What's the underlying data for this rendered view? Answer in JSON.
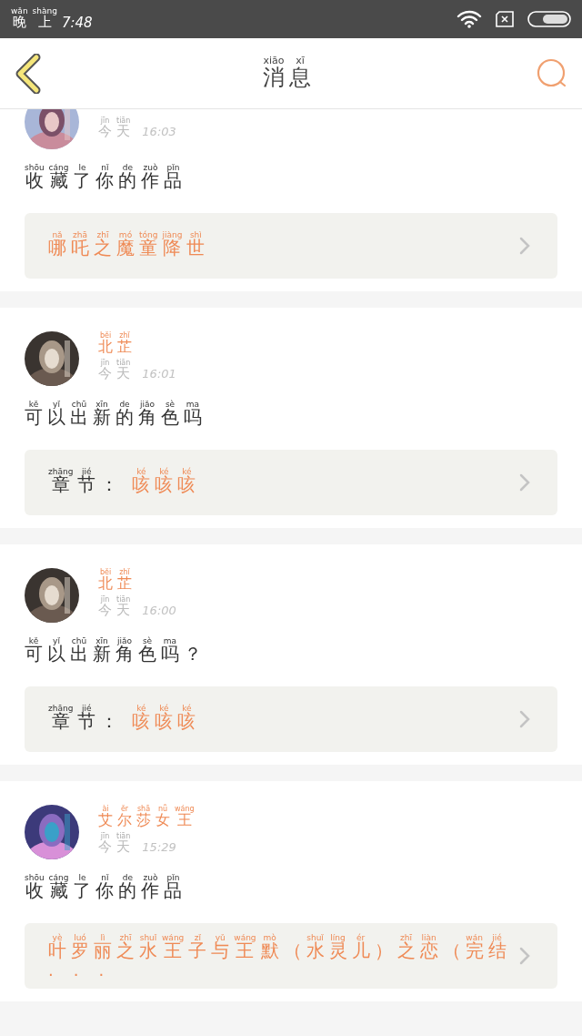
{
  "status_bar": {
    "period": [
      {
        "pinyin": "wǎn",
        "char": "晚"
      },
      {
        "pinyin": "shàng",
        "char": "上"
      }
    ],
    "time": "7:48"
  },
  "header": {
    "title": [
      {
        "pinyin": "xiāo",
        "char": "消"
      },
      {
        "pinyin": "xī",
        "char": "息"
      }
    ]
  },
  "messages": [
    {
      "date": [
        {
          "pinyin": "jīn",
          "char": "今"
        },
        {
          "pinyin": "tiān",
          "char": "天"
        }
      ],
      "time": "16:03",
      "text": [
        {
          "pinyin": "shōu",
          "char": "收"
        },
        {
          "pinyin": "cáng",
          "char": "藏"
        },
        {
          "pinyin": "le",
          "char": "了"
        },
        {
          "pinyin": "nǐ",
          "char": "你"
        },
        {
          "pinyin": "de",
          "char": "的"
        },
        {
          "pinyin": "zuò",
          "char": "作"
        },
        {
          "pinyin": "pǐn",
          "char": "品"
        }
      ],
      "link": {
        "kind": "work",
        "title": [
          {
            "pinyin": "nǎ",
            "char": "哪"
          },
          {
            "pinyin": "zhā",
            "char": "吒"
          },
          {
            "pinyin": "zhī",
            "char": "之"
          },
          {
            "pinyin": "mó",
            "char": "魔"
          },
          {
            "pinyin": "tóng",
            "char": "童"
          },
          {
            "pinyin": "jiàng",
            "char": "降"
          },
          {
            "pinyin": "shì",
            "char": "世"
          }
        ]
      }
    },
    {
      "name": [
        {
          "pinyin": "běi",
          "char": "北"
        },
        {
          "pinyin": "zhǐ",
          "char": "芷"
        }
      ],
      "date": [
        {
          "pinyin": "jīn",
          "char": "今"
        },
        {
          "pinyin": "tiān",
          "char": "天"
        }
      ],
      "time": "16:01",
      "text": [
        {
          "pinyin": "kě",
          "char": "可"
        },
        {
          "pinyin": "yǐ",
          "char": "以"
        },
        {
          "pinyin": "chū",
          "char": "出"
        },
        {
          "pinyin": "xīn",
          "char": "新"
        },
        {
          "pinyin": "de",
          "char": "的"
        },
        {
          "pinyin": "jiǎo",
          "char": "角"
        },
        {
          "pinyin": "sè",
          "char": "色"
        },
        {
          "pinyin": "ma",
          "char": "吗"
        }
      ],
      "link": {
        "kind": "chapter",
        "label": [
          {
            "pinyin": "zhāng",
            "char": "章"
          },
          {
            "pinyin": "jié",
            "char": "节"
          },
          {
            "char": "："
          }
        ],
        "title": [
          {
            "pinyin": "ké",
            "char": "咳"
          },
          {
            "pinyin": "ké",
            "char": "咳"
          },
          {
            "pinyin": "ké",
            "char": "咳"
          }
        ]
      }
    },
    {
      "name": [
        {
          "pinyin": "běi",
          "char": "北"
        },
        {
          "pinyin": "zhǐ",
          "char": "芷"
        }
      ],
      "date": [
        {
          "pinyin": "jīn",
          "char": "今"
        },
        {
          "pinyin": "tiān",
          "char": "天"
        }
      ],
      "time": "16:00",
      "text": [
        {
          "pinyin": "kě",
          "char": "可"
        },
        {
          "pinyin": "yǐ",
          "char": "以"
        },
        {
          "pinyin": "chū",
          "char": "出"
        },
        {
          "pinyin": "xīn",
          "char": "新"
        },
        {
          "pinyin": "jiǎo",
          "char": "角"
        },
        {
          "pinyin": "sè",
          "char": "色"
        },
        {
          "pinyin": "ma",
          "char": "吗"
        },
        {
          "char": "？"
        }
      ],
      "link": {
        "kind": "chapter",
        "label": [
          {
            "pinyin": "zhāng",
            "char": "章"
          },
          {
            "pinyin": "jié",
            "char": "节"
          },
          {
            "char": "："
          }
        ],
        "title": [
          {
            "pinyin": "ké",
            "char": "咳"
          },
          {
            "pinyin": "ké",
            "char": "咳"
          },
          {
            "pinyin": "ké",
            "char": "咳"
          }
        ]
      }
    },
    {
      "name": [
        {
          "pinyin": "ài",
          "char": "艾"
        },
        {
          "pinyin": "ěr",
          "char": "尔"
        },
        {
          "pinyin": "shā",
          "char": "莎"
        },
        {
          "pinyin": "nǚ",
          "char": "女"
        },
        {
          "pinyin": "wáng",
          "char": "王"
        }
      ],
      "date": [
        {
          "pinyin": "jīn",
          "char": "今"
        },
        {
          "pinyin": "tiān",
          "char": "天"
        }
      ],
      "time": "15:29",
      "text": [
        {
          "pinyin": "shōu",
          "char": "收"
        },
        {
          "pinyin": "cáng",
          "char": "藏"
        },
        {
          "pinyin": "le",
          "char": "了"
        },
        {
          "pinyin": "nǐ",
          "char": "你"
        },
        {
          "pinyin": "de",
          "char": "的"
        },
        {
          "pinyin": "zuò",
          "char": "作"
        },
        {
          "pinyin": "pǐn",
          "char": "品"
        }
      ],
      "link": {
        "kind": "work",
        "title": [
          {
            "pinyin": "yè",
            "char": "叶"
          },
          {
            "pinyin": "luó",
            "char": "罗"
          },
          {
            "pinyin": "lì",
            "char": "丽"
          },
          {
            "pinyin": "zhī",
            "char": "之"
          },
          {
            "pinyin": "shuǐ",
            "char": "水"
          },
          {
            "pinyin": "wáng",
            "char": "王"
          },
          {
            "pinyin": "zǐ",
            "char": "子"
          },
          {
            "pinyin": "yǔ",
            "char": "与"
          },
          {
            "pinyin": "wáng",
            "char": "王"
          },
          {
            "pinyin": "mò",
            "char": "默"
          },
          {
            "char": "（"
          },
          {
            "pinyin": "shuǐ",
            "char": "水"
          },
          {
            "pinyin": "líng",
            "char": "灵"
          },
          {
            "pinyin": "ér",
            "char": "儿"
          },
          {
            "char": "）"
          },
          {
            "pinyin": "zhī",
            "char": "之"
          },
          {
            "pinyin": "liàn",
            "char": "恋"
          },
          {
            "char": "（"
          },
          {
            "pinyin": "wán",
            "char": "完"
          },
          {
            "pinyin": "jié",
            "char": "结"
          }
        ],
        "overflow": "..."
      }
    }
  ]
}
